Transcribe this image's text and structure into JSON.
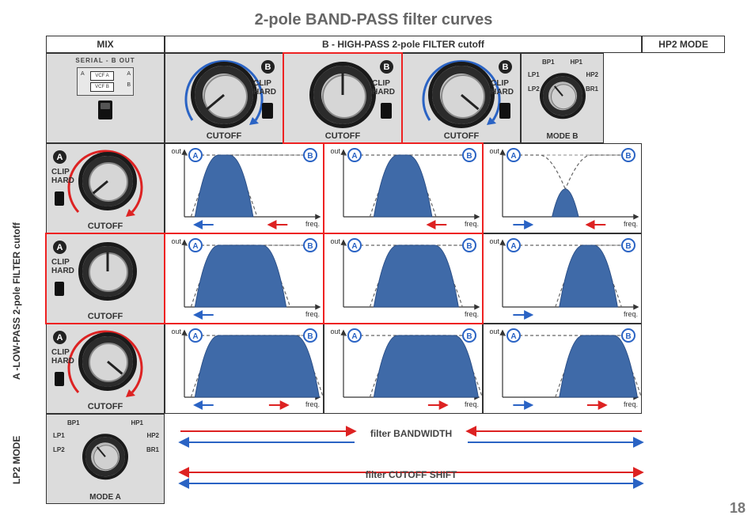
{
  "title": "2-pole BAND-PASS filter curves",
  "page_number": "18",
  "columns": {
    "mix": "MIX",
    "b_header": "B - HIGH-PASS 2-pole FILTER cutoff",
    "hp2_mode": "HP2 MODE"
  },
  "rows": {
    "a_header": "A -LOW-PASS 2-pole FILTER cutoff",
    "lp2_mode": "LP2 MODE"
  },
  "mix_panel": {
    "subtitle": "SERIAL - B OUT",
    "box_a": "VCF A",
    "box_b": "VCF B",
    "in_a": "A",
    "in_b": "B",
    "out_a": "A",
    "out_b": "B"
  },
  "knob": {
    "label": "CUTOFF",
    "clip": "CLIP\nHARD"
  },
  "mode": {
    "label_a": "MODE A",
    "label_b": "MODE B",
    "ticks": {
      "lp1": "LP1",
      "bp1": "BP1",
      "hp1": "HP1",
      "lp2": "LP2",
      "hp2": "HP2",
      "br1": "BR1"
    }
  },
  "plot": {
    "ylabel": "out",
    "xlabel": "freq.",
    "marker_a": "A",
    "marker_b": "B"
  },
  "top_knobs": [
    {
      "badge": "B",
      "angle": -130,
      "arc": "blue",
      "highlight": false
    },
    {
      "badge": "B",
      "angle": 0,
      "arc": "none",
      "highlight": true
    },
    {
      "badge": "B",
      "angle": 130,
      "arc": "blue",
      "highlight": false
    }
  ],
  "left_knobs": [
    {
      "badge": "A",
      "angle": -130,
      "arc": "red",
      "highlight": false
    },
    {
      "badge": "A",
      "angle": 0,
      "arc": "none",
      "highlight": true
    },
    {
      "badge": "A",
      "angle": 130,
      "arc": "red",
      "highlight": false
    }
  ],
  "chart_data": {
    "type": "grid-of-response-curves",
    "description": "3x3 matrix of band-pass filter frequency-response plots. Column = high-pass (B) cutoff position, Row = low-pass (A) cutoff position. Each plot shows amplitude (out) vs frequency. Solid blue filled region = band-pass result; dashed curves = component LP and HP envelopes. Arrows beneath each plot show direction of cutoff movement.",
    "x_axis": "freq.",
    "y_axis": "out",
    "col_meaning": [
      "B cutoff low",
      "B cutoff mid",
      "B cutoff high"
    ],
    "row_meaning": [
      "A cutoff low",
      "A cutoff mid",
      "A cutoff high"
    ],
    "plots": [
      [
        {
          "hp_pos": 0.2,
          "lp_pos": 0.4,
          "band": [
            0.2,
            0.4
          ],
          "arrow_a": "left_blue",
          "arrow_b": "left_red",
          "highlight": false
        },
        {
          "hp_pos": 0.35,
          "lp_pos": 0.55,
          "band": [
            0.35,
            0.55
          ],
          "arrow_a": "none",
          "arrow_b": "left_red",
          "highlight": true
        },
        {
          "hp_pos": 0.55,
          "lp_pos": 0.4,
          "band": [
            0.55,
            0.4
          ],
          "narrow": true,
          "arrow_a": "right_blue",
          "arrow_b": "left_red",
          "highlight": false
        }
      ],
      [
        {
          "hp_pos": 0.2,
          "lp_pos": 0.65,
          "band": [
            0.2,
            0.65
          ],
          "arrow_a": "left_blue",
          "arrow_b": "none",
          "highlight": true
        },
        {
          "hp_pos": 0.35,
          "lp_pos": 0.75,
          "band": [
            0.35,
            0.75
          ],
          "arrow_a": "none",
          "arrow_b": "none",
          "highlight": true
        },
        {
          "hp_pos": 0.55,
          "lp_pos": 0.75,
          "band": [
            0.55,
            0.75
          ],
          "arrow_a": "right_blue",
          "arrow_b": "none",
          "highlight": false
        }
      ],
      [
        {
          "hp_pos": 0.2,
          "lp_pos": 0.9,
          "band": [
            0.2,
            0.9
          ],
          "arrow_a": "left_blue",
          "arrow_b": "right_red",
          "highlight": false
        },
        {
          "hp_pos": 0.35,
          "lp_pos": 0.9,
          "band": [
            0.35,
            0.9
          ],
          "arrow_a": "none",
          "arrow_b": "right_red",
          "highlight": false
        },
        {
          "hp_pos": 0.55,
          "lp_pos": 0.9,
          "band": [
            0.55,
            0.9
          ],
          "arrow_a": "right_blue",
          "arrow_b": "right_red",
          "highlight": false
        }
      ]
    ]
  },
  "bottom_labels": {
    "bandwidth": "filter BANDWIDTH",
    "cutoff_shift": "filter CUTOFF SHIFT"
  }
}
